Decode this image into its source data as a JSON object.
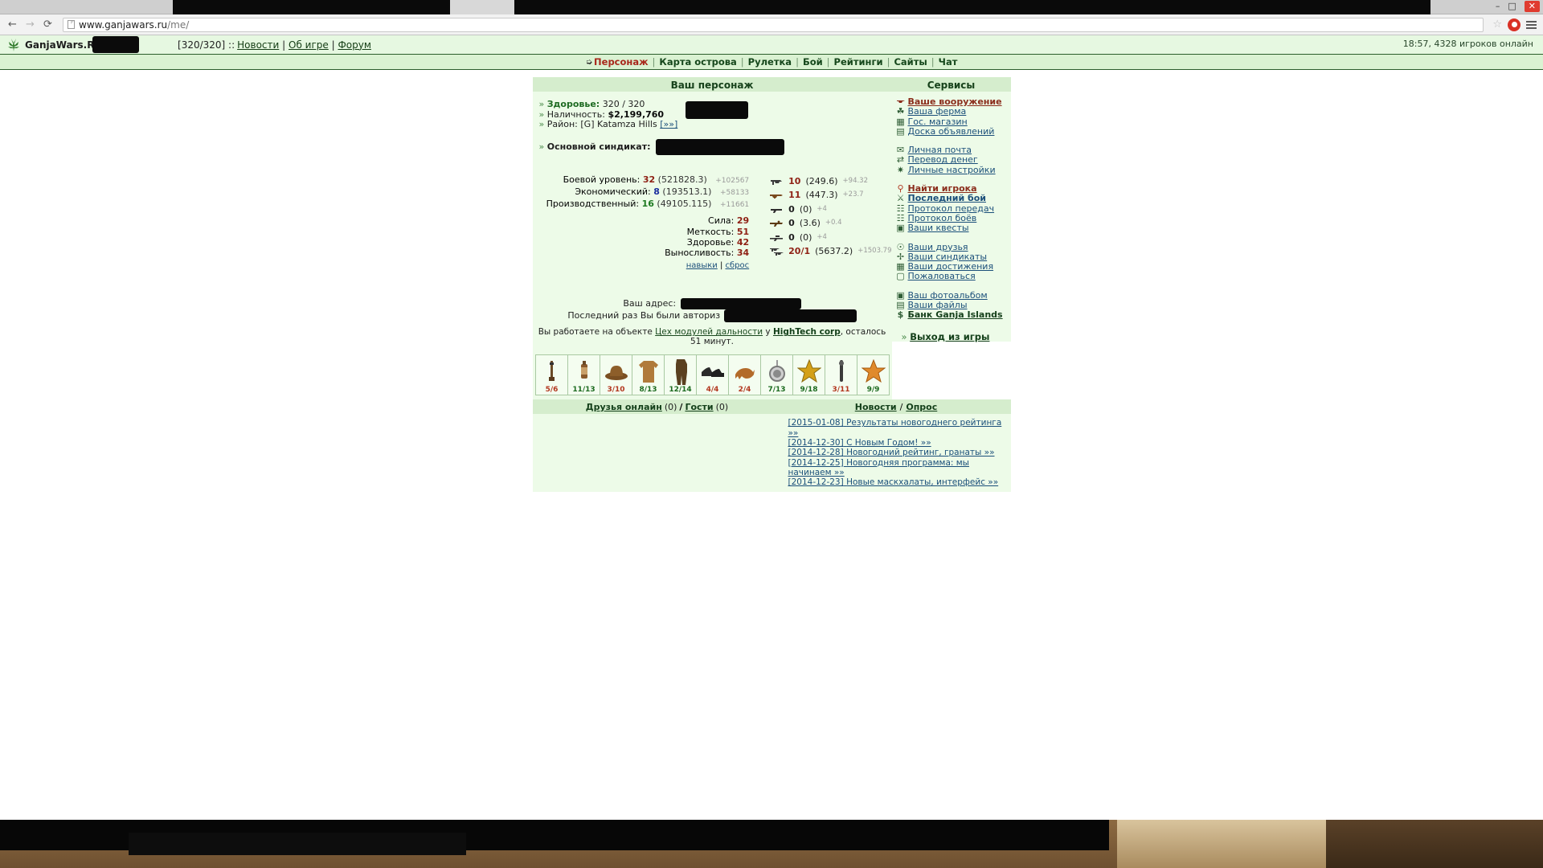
{
  "browser": {
    "url_domain": "www.ganjawars.ru",
    "url_path": "/me/",
    "back_icon": "back-arrow-icon",
    "forward_icon": "forward-arrow-icon",
    "reload_icon": "reload-icon",
    "star_icon": "bookmark-star-icon",
    "extension_icon": "extension-badge-icon",
    "menu_icon": "hamburger-menu-icon",
    "minimize_label": "–",
    "maximize_label": "□",
    "close_label": "✕"
  },
  "site_header": {
    "brand": "GanjaWars.Ru",
    "separator1": " :: ",
    "hp_bracket": "[320/320] ::",
    "links": [
      {
        "label": "Новости"
      },
      {
        "label": "Об игре"
      },
      {
        "label": "Форум"
      }
    ],
    "online_status": "18:57, 4328 игроков онлайн"
  },
  "menu": {
    "items": [
      {
        "label": "Персонаж",
        "active": true
      },
      {
        "label": "Карта острова",
        "active": false
      },
      {
        "label": "Рулетка",
        "active": false
      },
      {
        "label": "Бой",
        "active": false
      },
      {
        "label": "Рейтинги",
        "active": false
      },
      {
        "label": "Сайты",
        "active": false
      },
      {
        "label": "Чат",
        "active": false
      }
    ]
  },
  "character": {
    "panel_title": "Ваш персонаж",
    "health_label": "Здоровье:",
    "health_value": "320 / 320",
    "cash_label": "Наличность:",
    "cash_value": "$2,199,760",
    "district_label": "Район:",
    "district_value": "[G] Katamza Hills",
    "district_link": "[»»]",
    "syndicate_label": "Основной синдикат:",
    "levels": [
      {
        "label": "Боевой уровень:",
        "value": "32",
        "exp": "(521828.3)",
        "bonus": "+102567",
        "color": "red"
      },
      {
        "label": "Экономический:",
        "value": "8",
        "exp": "(193513.1)",
        "bonus": "+58133",
        "color": "blue"
      },
      {
        "label": "Производственный:",
        "value": "16",
        "exp": "(49105.115)",
        "bonus": "+11661",
        "color": "green"
      }
    ],
    "attributes": [
      {
        "label": "Сила:",
        "value": "29"
      },
      {
        "label": "Меткость:",
        "value": "51"
      },
      {
        "label": "Здоровье:",
        "value": "42"
      },
      {
        "label": "Выносливость:",
        "value": "34"
      }
    ],
    "skills_link": "навыки",
    "skills_sep": "|",
    "reset_link": "сброс",
    "equipment": [
      {
        "icon": "pistol-icon",
        "amount": "10",
        "value": "(249.6)",
        "bonus": "+94.32",
        "highlight": true
      },
      {
        "icon": "smg-icon",
        "amount": "11",
        "value": "(447.3)",
        "bonus": "+23.7",
        "highlight": true
      },
      {
        "icon": "shotgun-icon",
        "amount": "0",
        "value": "(0)",
        "bonus": "+4",
        "highlight": false
      },
      {
        "icon": "rifle-icon",
        "amount": "0",
        "value": "(3.6)",
        "bonus": "+0.4",
        "highlight": false
      },
      {
        "icon": "sniper-icon",
        "amount": "0",
        "value": "(0)",
        "bonus": "+4",
        "highlight": false
      },
      {
        "icon": "dual-pistols-icon",
        "amount": "20/1",
        "value": "(5637.2)",
        "bonus": "+1503.79",
        "highlight": true
      }
    ],
    "address_label": "Ваш адрес:",
    "lastlogin_label": "Последний раз Вы были авториз",
    "work_prefix": "Вы работаете на объекте",
    "work_object": "Цех модулей дальности",
    "work_at": "у",
    "work_company": "HighTech corp",
    "work_suffix": ", осталось 51 минут."
  },
  "inventory": [
    {
      "icon": "rifle-item-icon",
      "count": "5/6",
      "warn": true
    },
    {
      "icon": "drink-item-icon",
      "count": "11/13",
      "warn": false
    },
    {
      "icon": "hat-item-icon",
      "count": "3/10",
      "warn": true
    },
    {
      "icon": "jacket-item-icon",
      "count": "8/13",
      "warn": false
    },
    {
      "icon": "suit-item-icon",
      "count": "12/14",
      "warn": false
    },
    {
      "icon": "shoes-item-icon",
      "count": "4/4",
      "warn": true
    },
    {
      "icon": "dog-item-icon",
      "count": "2/4",
      "warn": true
    },
    {
      "icon": "medallion-item-icon",
      "count": "7/13",
      "warn": false
    },
    {
      "icon": "badge-item-icon",
      "count": "9/18",
      "warn": false
    },
    {
      "icon": "baton-item-icon",
      "count": "3/11",
      "warn": true
    },
    {
      "icon": "star-item-icon",
      "count": "9/9",
      "warn": false
    }
  ],
  "sidebar": {
    "panel_title": "Сервисы",
    "groups": [
      [
        {
          "icon": "weapon-icon",
          "label": "Ваше вооружение",
          "style": "strong"
        },
        {
          "icon": "farm-icon",
          "label": "Ваша ферма",
          "style": ""
        },
        {
          "icon": "shop-icon",
          "label": "Гос. магазин",
          "style": ""
        },
        {
          "icon": "board-icon",
          "label": "Доска объявлений",
          "style": ""
        }
      ],
      [
        {
          "icon": "mail-icon",
          "label": "Личная почта",
          "style": ""
        },
        {
          "icon": "transfer-icon",
          "label": "Перевод денег",
          "style": ""
        },
        {
          "icon": "settings-icon",
          "label": "Личные настройки",
          "style": ""
        }
      ],
      [
        {
          "icon": "search-icon",
          "label": "Найти игрока",
          "style": "strong"
        },
        {
          "icon": "fight-icon",
          "label": "Последний бой",
          "style": "bold"
        },
        {
          "icon": "log-icon",
          "label": "Протокол передач",
          "style": ""
        },
        {
          "icon": "log2-icon",
          "label": "Протокол боёв",
          "style": ""
        },
        {
          "icon": "quest-icon",
          "label": "Ваши квесты",
          "style": ""
        }
      ],
      [
        {
          "icon": "friends-icon",
          "label": "Ваши друзья",
          "style": ""
        },
        {
          "icon": "syndicate-icon",
          "label": "Ваши синдикаты",
          "style": ""
        },
        {
          "icon": "achievement-icon",
          "label": "Ваши достижения",
          "style": ""
        },
        {
          "icon": "complain-icon",
          "label": "Пожаловаться",
          "style": ""
        }
      ],
      [
        {
          "icon": "photo-icon",
          "label": "Ваш фотоальбом",
          "style": ""
        },
        {
          "icon": "files-icon",
          "label": "Ваши файлы",
          "style": ""
        },
        {
          "icon": "bank-icon",
          "label": "Банк Ganja Islands",
          "style": "dark"
        }
      ]
    ],
    "exit_label": "Выход из игры"
  },
  "bottom": {
    "friends_online": "Друзья онлайн",
    "friends_count": "(0)",
    "slash": "/",
    "guests": "Гости",
    "guests_count": "(0)",
    "news_label": "Новости",
    "poll_label": "Опрос",
    "news": [
      {
        "date": "[2015-01-08]",
        "text": "Результаты новогоднего рейтинга »»"
      },
      {
        "date": "[2014-12-30]",
        "text": "С Новым Годом! »»"
      },
      {
        "date": "[2014-12-28]",
        "text": "Новогодний рейтинг, гранаты »»"
      },
      {
        "date": "[2014-12-25]",
        "text": "Новогодняя программа: мы начинаем »»"
      },
      {
        "date": "[2014-12-23]",
        "text": "Новые маскхалаты, интерфейс »»"
      }
    ]
  }
}
